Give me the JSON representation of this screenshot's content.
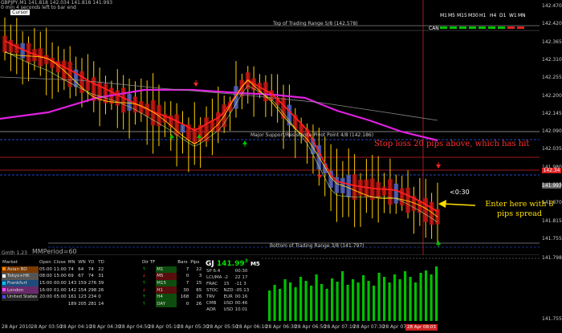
{
  "header": {
    "symbol_line": "GBPJPY,M1  141.818 142.034 141.818 141.993",
    "info_line": "0 min 4 seconds left to bar end",
    "cursor_button": "Cursor"
  },
  "timeframes": [
    "M1",
    "M5",
    "M15",
    "M30",
    "H1",
    "H4",
    "D1",
    "W1",
    "MN"
  ],
  "can_label": "CAN",
  "range_labels": {
    "top": "Top of Trading Range  5/8  (142.578)",
    "support": "Major Support/Resistance Pivot Point  4/8  (142.186)",
    "bottom": "Bottom of Trading Range  3/8  (141.797)"
  },
  "price_axis": [
    "142.470",
    "142.420",
    "142.365",
    "142.310",
    "142.255",
    "142.200",
    "142.145",
    "142.090",
    "142.035",
    "141.980",
    "141.925",
    "141.870",
    "141.815",
    "141.755"
  ],
  "price_tags": [
    {
      "text": "142.34",
      "color": "#dd2222"
    },
    {
      "text": "141.993",
      "color": "#666666"
    }
  ],
  "annotations": {
    "stop_loss": "Stop loss 20 pips above, which has hit",
    "enter_here": "Enter here with 8 pips spread",
    "countdown": "<0:30"
  },
  "subpanel": {
    "left_label": "Gmth 1.23",
    "mm_label": "MMPeriod=60",
    "right_axis": [
      "141.798",
      "141.755"
    ]
  },
  "sessions": {
    "headers": [
      "Market",
      "Open",
      "Close",
      "MN",
      "WN",
      "YD",
      "TD"
    ],
    "rows": [
      {
        "name": "Asian BO",
        "open": "05:00",
        "close": "11:00",
        "mn": "74",
        "wn": "64",
        "yd": "74",
        "td": "22",
        "color": "#ff8800"
      },
      {
        "name": "Tokyo+HK",
        "open": "08:00",
        "close": "15:00",
        "mn": "69",
        "wn": "67",
        "yd": "74",
        "td": "31",
        "color": "#ffffff"
      },
      {
        "name": "Frankfurt",
        "open": "15:00",
        "close": "00:00",
        "mn": "143",
        "wn": "159",
        "yd": "276",
        "td": "39",
        "color": "#00c0ff"
      },
      {
        "name": "London",
        "open": "16:00",
        "close": "01:00",
        "mn": "142",
        "wn": "154",
        "yd": "298",
        "td": "26",
        "color": "#ff44ff"
      },
      {
        "name": "United States",
        "open": "20:00",
        "close": "05:00",
        "mn": "161",
        "wn": "123",
        "yd": "234",
        "td": "0",
        "color": "#4444ff"
      },
      {
        "name": "",
        "open": "",
        "close": "",
        "mn": "189",
        "wn": "205",
        "yd": "281",
        "td": "14",
        "color": "#000000"
      }
    ]
  },
  "direction_table": {
    "headers": [
      "Dir TF",
      "",
      "Bars",
      "Pips"
    ],
    "rows": [
      {
        "dir": "up",
        "tf": "M1",
        "bars": "7",
        "pips": "22"
      },
      {
        "dir": "down",
        "tf": "M5",
        "bars": "0",
        "pips": "3"
      },
      {
        "dir": "up",
        "tf": "M15",
        "bars": "7",
        "pips": "15"
      },
      {
        "dir": "down",
        "tf": "H1",
        "bars": "30",
        "pips": "65"
      },
      {
        "dir": "up",
        "tf": "H4",
        "bars": "168",
        "pips": "26"
      },
      {
        "dir": "up",
        "tf": "DAY",
        "bars": "0",
        "pips": "26"
      }
    ]
  },
  "gj_panel": {
    "symbol": "GJ",
    "price": "141.99",
    "price_sup": "3",
    "tf": "M5",
    "rows": [
      [
        "SP 6.4",
        "",
        "00:30"
      ],
      [
        "LCUMA",
        "-2",
        "22  17"
      ],
      [
        "FRAC",
        "15",
        "-11  3"
      ],
      [
        "STOC",
        "NZD",
        "-05.13"
      ],
      [
        "TRV",
        "EUR",
        "00.16"
      ],
      [
        "CMB",
        "USD",
        "00.46"
      ],
      [
        "ADR",
        "USD",
        "10.01"
      ]
    ]
  },
  "time_axis": [
    "28 Apr 2010",
    "28 Apr 03:50",
    "28 Apr 04:10",
    "28 Apr 04:30",
    "28 Apr 04:50",
    "28 Apr 05:10",
    "28 Apr 05:30",
    "28 Apr 05:50",
    "28 Apr 06:10",
    "28 Apr 06:30",
    "28 Apr 06:50",
    "28 Apr 07:10",
    "28 Apr 07:30",
    "28 Apr 07:50",
    "Apr 08:10"
  ],
  "time_highlight": "28 Apr 08:03",
  "colors": {
    "bull_bar": "#5060c8",
    "bear_bar": "#c81010",
    "wick": "#ffd000",
    "ma_magenta": "#e020e0",
    "ma_red": "#ff2020",
    "ma_yellow": "#ffd000",
    "volume": "#00c000"
  }
}
